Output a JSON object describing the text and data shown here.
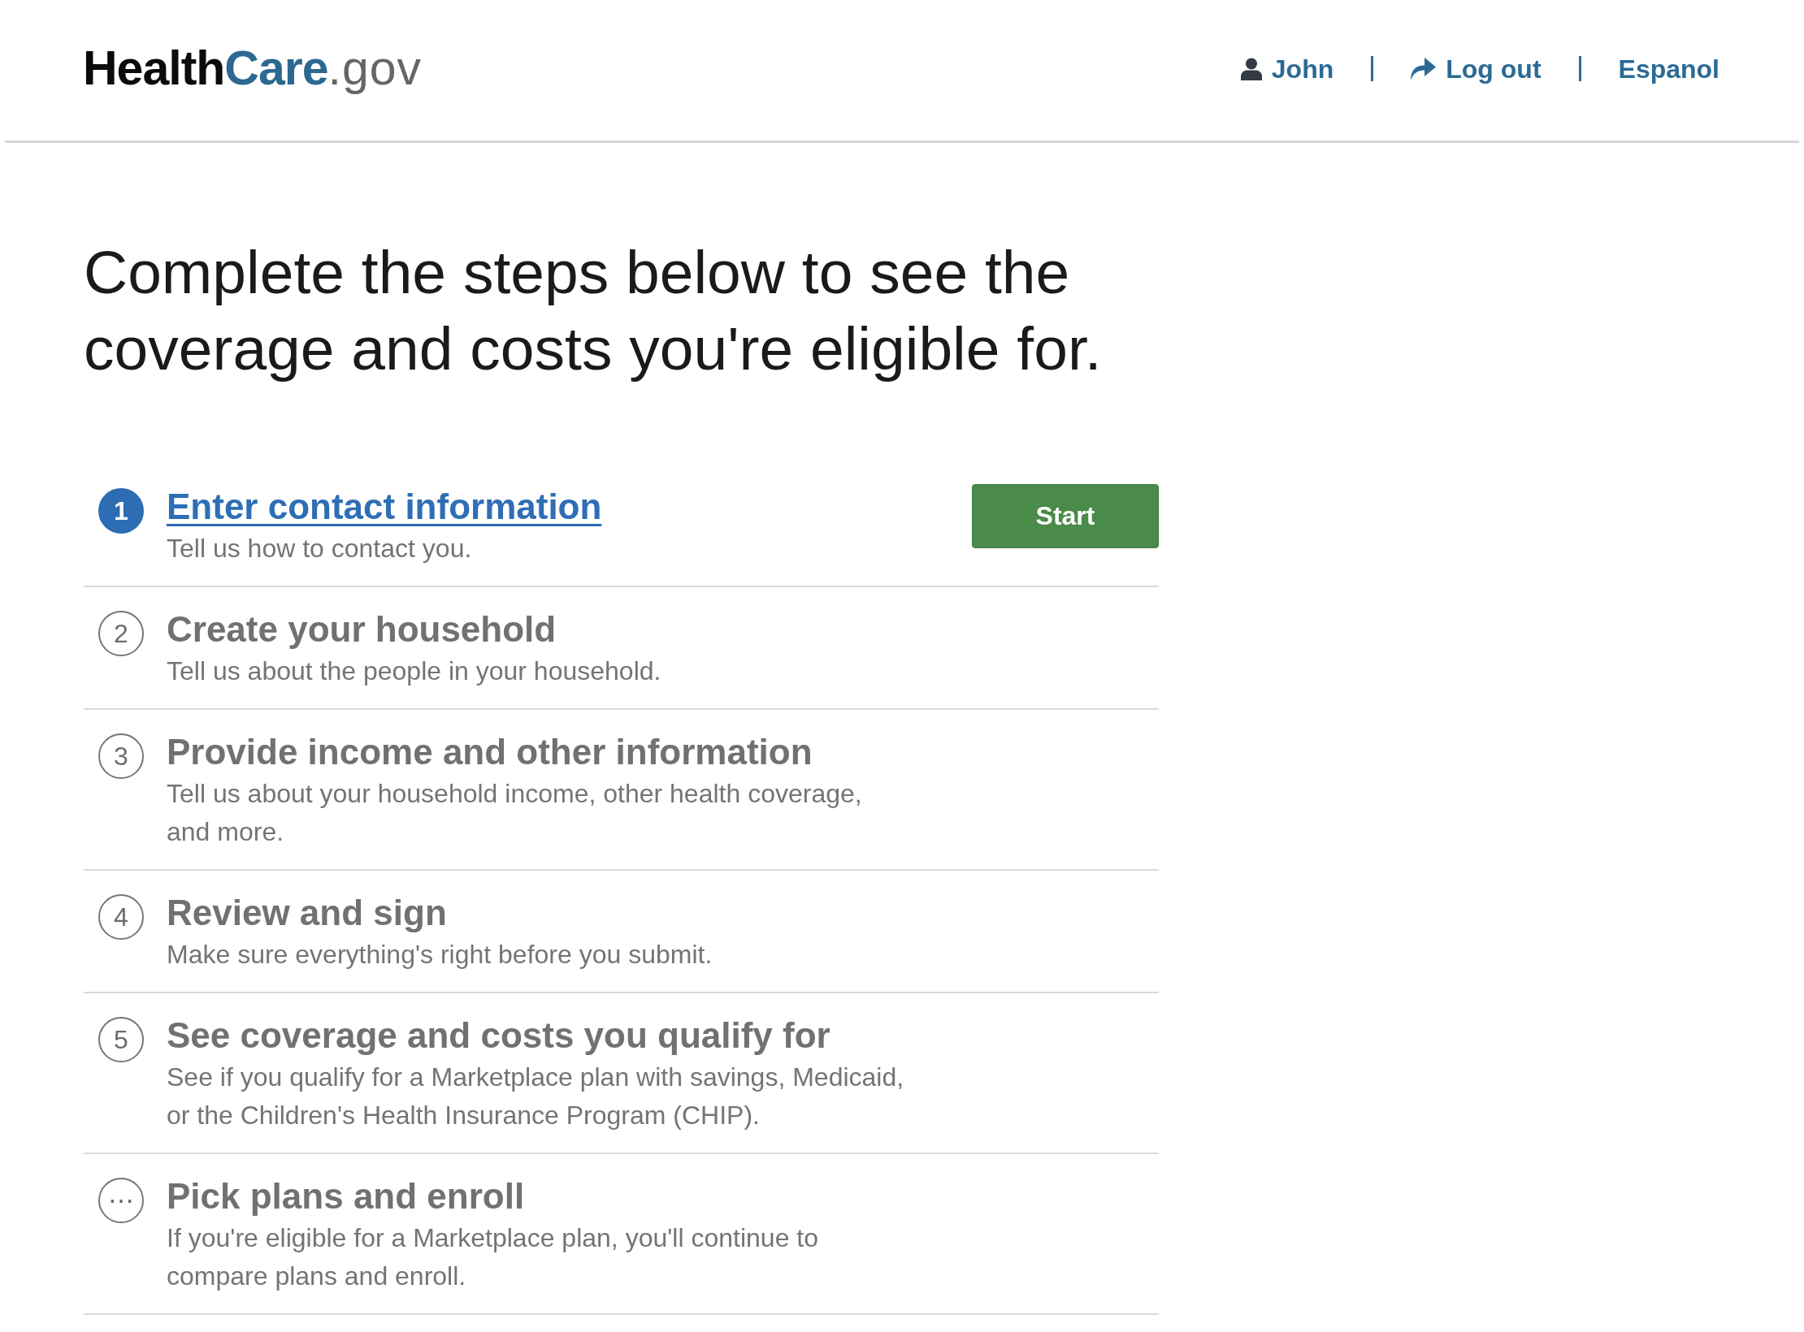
{
  "header": {
    "logo": [
      {
        "text": "Health",
        "kind": "dark"
      },
      {
        "text": "Care",
        "kind": "accent"
      },
      {
        "text": ".gov",
        "kind": "light"
      }
    ],
    "nav": [
      {
        "label": "John",
        "kind": "user"
      },
      {
        "label": "Log out",
        "kind": "logout"
      },
      {
        "label": "Espanol",
        "kind": "plain"
      }
    ]
  },
  "heading": "Complete the steps below to see the coverage and costs you're eligible for.",
  "steps": [
    {
      "marker": "1",
      "title": "Enter contact information",
      "description": "Tell us how to contact you.",
      "current": true,
      "action": "Start"
    },
    {
      "marker": "2",
      "title": "Create your household",
      "description": "Tell us about the people in your household.",
      "current": false
    },
    {
      "marker": "3",
      "title": "Provide income and other information",
      "description": "Tell us about your household income, other health coverage, and more.",
      "current": false
    },
    {
      "marker": "4",
      "title": "Review and sign",
      "description": "Make sure everything's right before you submit.",
      "current": false
    },
    {
      "marker": "5",
      "title": "See coverage and costs you qualify for",
      "description": "See if you qualify for a Marketplace plan with savings, Medicaid, or the Children's Health Insurance Program (CHIP).",
      "current": false
    },
    {
      "marker": "⋯",
      "title": "Pick plans and enroll",
      "description": "If you're eligible for a Marketplace plan, you'll continue to compare plans and enroll.",
      "current": false
    }
  ]
}
